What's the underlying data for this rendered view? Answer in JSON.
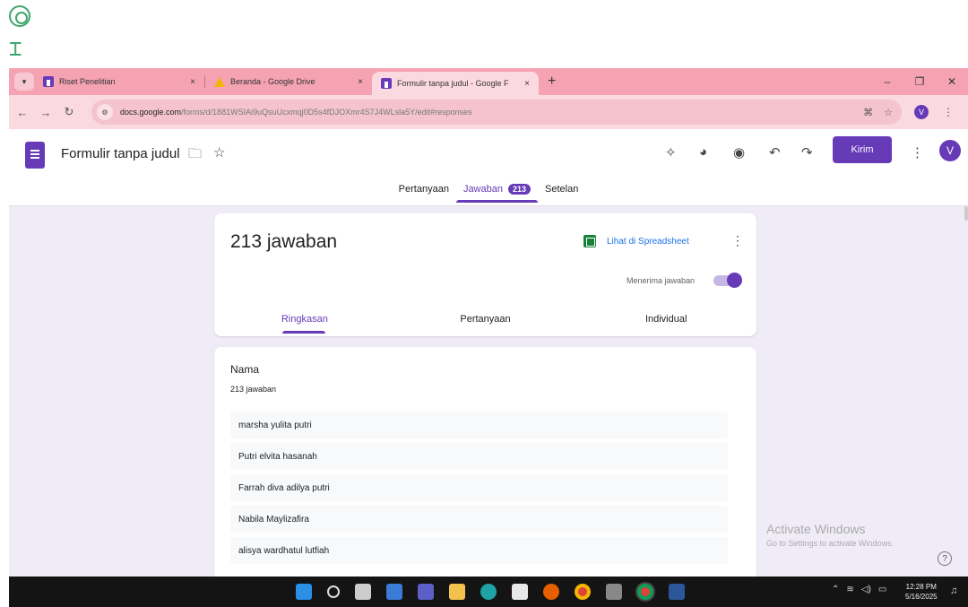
{
  "browser": {
    "tabs": [
      {
        "label": "Riset Penelitian",
        "icon": "forms-icon"
      },
      {
        "label": "Beranda - Google Drive",
        "icon": "drive-icon"
      },
      {
        "label": "Formulir tanpa judul - Google F",
        "icon": "forms-icon",
        "active": true
      }
    ],
    "close_glyph": "×",
    "new_tab": "+",
    "win_controls": {
      "minimize": "–",
      "restore": "❐",
      "close": "✕"
    },
    "url_host": "docs.google.com",
    "url_rest": "/forms/d/1881WSIAi9uQsuUcxmqj0D5s4fDJOXmr4S7J4WLsla5Y/edit#responses",
    "profile_initial": "V"
  },
  "header": {
    "doc_title": "Formulir tanpa judul",
    "send_label": "Kirim",
    "avatar_initial": "V",
    "tabs": {
      "questions": "Pertanyaan",
      "responses": "Jawaban",
      "responses_count": "213",
      "settings": "Setelan"
    }
  },
  "summary": {
    "title": "213 jawaban",
    "spreadsheet_link": "Lihat di Spreadsheet",
    "accepting_label": "Menerima jawaban",
    "accepting": true,
    "sub_tabs": [
      "Ringkasan",
      "Pertanyaan",
      "Individual"
    ]
  },
  "question": {
    "title": "Nama",
    "count": "213 jawaban",
    "answers": [
      "marsha yulita putri",
      "Putri elvita hasanah",
      "Farrah diva adilya putri",
      "Nabila Maylizafira",
      "alisya wardhatul lutfiah"
    ]
  },
  "watermark": {
    "title": "Activate Windows",
    "subtitle": "Go to Settings to activate Windows."
  },
  "taskbar": {
    "time": "12:28 PM",
    "date": "5/16/2025"
  },
  "colors": {
    "accent": "#673ab7",
    "tab_strip": "#f5a3b3",
    "page_bg": "#efebf7",
    "sheets_green": "#188038"
  }
}
